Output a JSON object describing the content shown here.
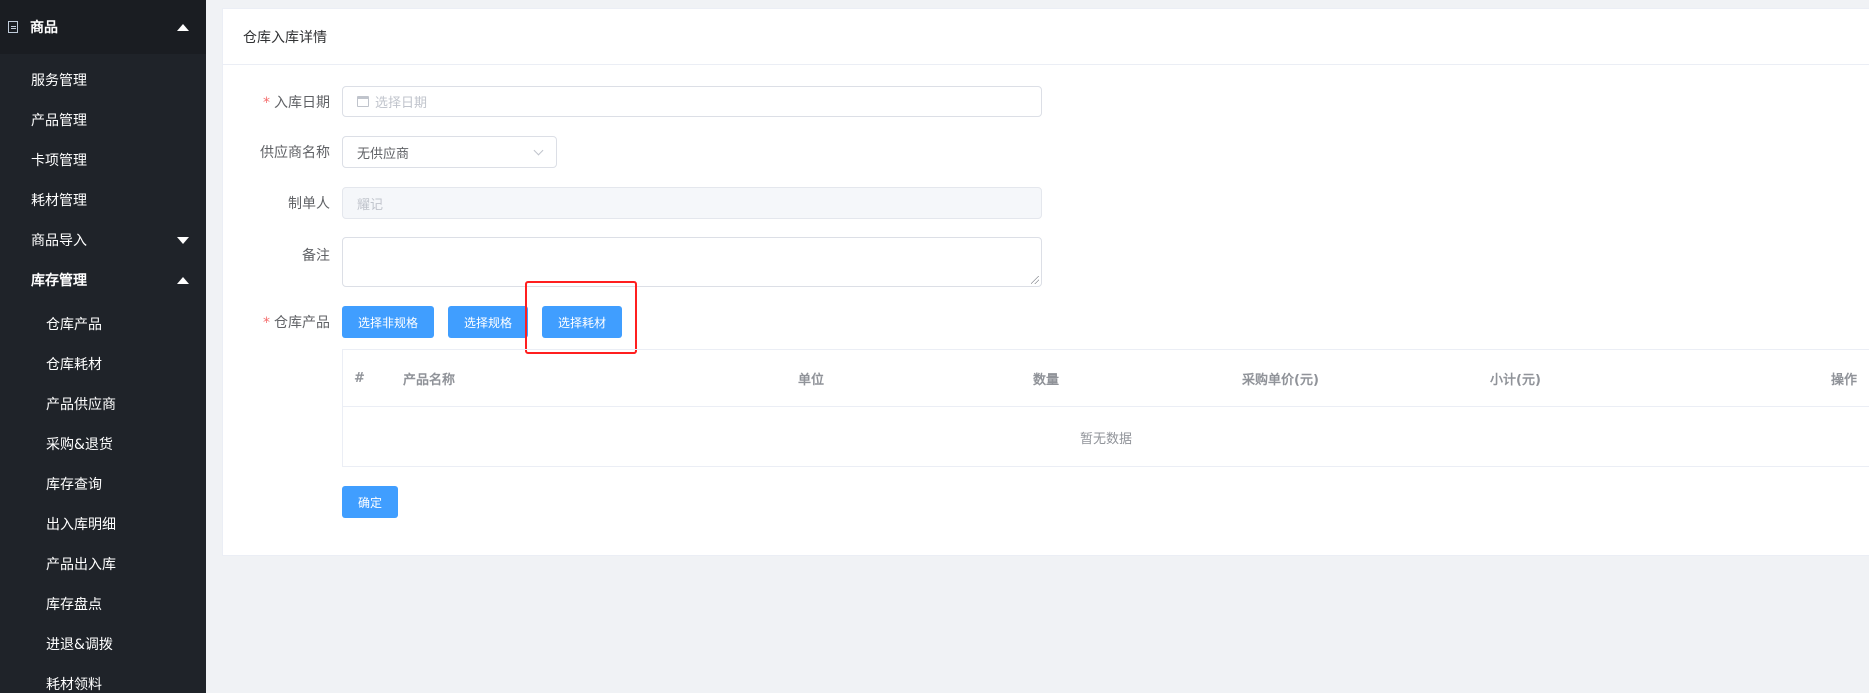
{
  "sidebar": {
    "group_label": "商品",
    "items": [
      {
        "label": "服务管理"
      },
      {
        "label": "产品管理"
      },
      {
        "label": "卡项管理"
      },
      {
        "label": "耗材管理"
      },
      {
        "label": "商品导入"
      },
      {
        "label": "库存管理"
      }
    ],
    "sub_items": [
      {
        "label": "仓库产品"
      },
      {
        "label": "仓库耗材"
      },
      {
        "label": "产品供应商"
      },
      {
        "label": "采购&退货"
      },
      {
        "label": "库存查询"
      },
      {
        "label": "出入库明细"
      },
      {
        "label": "产品出入库"
      },
      {
        "label": "库存盘点"
      },
      {
        "label": "进退&调拨"
      },
      {
        "label": "耗材领料"
      }
    ]
  },
  "panel": {
    "title": "仓库入库详情"
  },
  "form": {
    "date_label": "入库日期",
    "date_placeholder": "选择日期",
    "supplier_label": "供应商名称",
    "supplier_value": "无供应商",
    "creator_label": "制单人",
    "creator_value": "耀记",
    "remark_label": "备注",
    "products_label": "仓库产品",
    "required_mark": "*"
  },
  "buttons": {
    "select_non_spec": "选择非规格",
    "select_spec": "选择规格",
    "select_material": "选择耗材",
    "confirm": "确定"
  },
  "table": {
    "headers": [
      "#",
      "产品名称",
      "单位",
      "数量",
      "采购单价(元)",
      "小计(元)",
      "操作"
    ],
    "empty_text": "暂无数据"
  },
  "colors": {
    "sidebar_bg": "#1f2329",
    "primary": "#409eff",
    "required": "#f56c6c",
    "highlight": "#ff1f1f"
  }
}
